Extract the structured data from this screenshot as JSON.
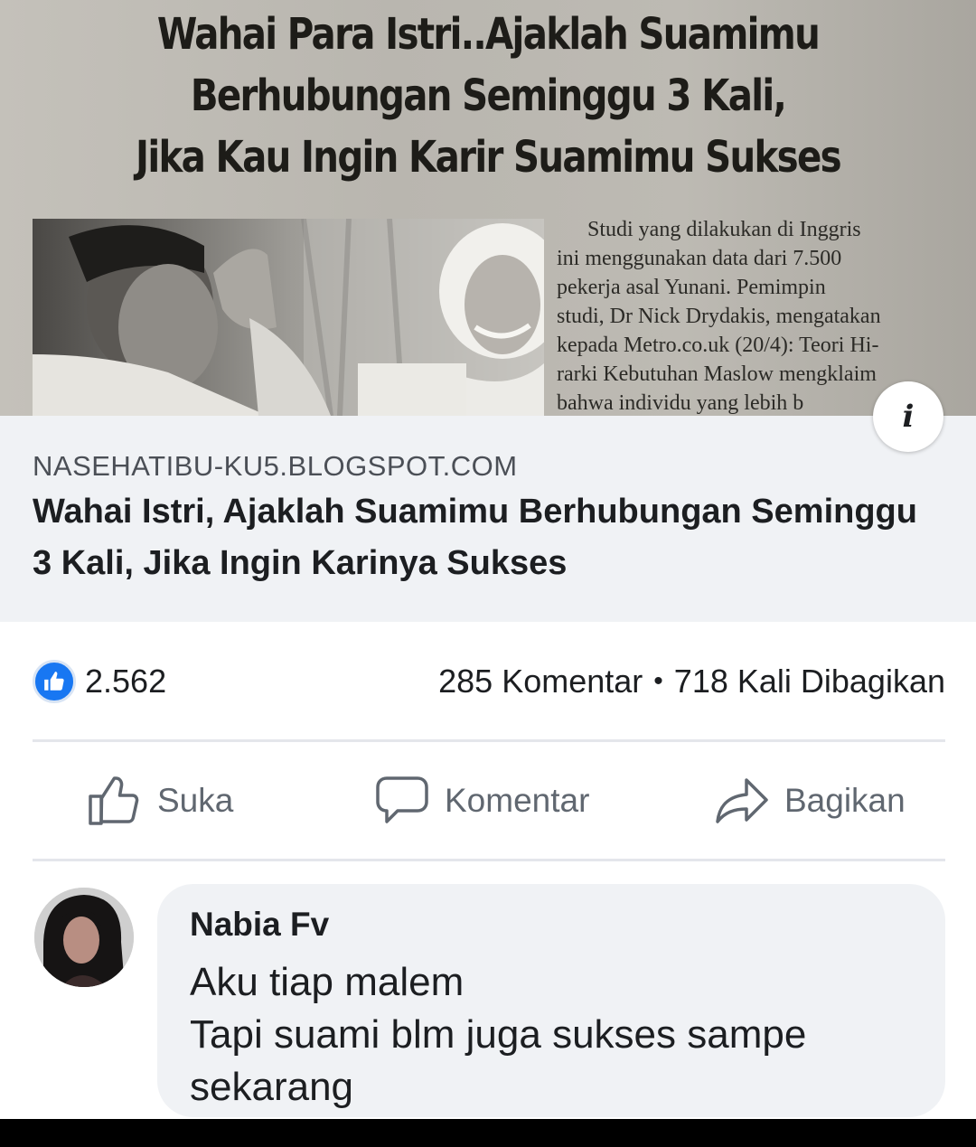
{
  "preview": {
    "headline": [
      "Wahai Para Istri..Ajaklah Suamimu",
      "Berhubungan Seminggu 3 Kali,",
      "Jika Kau Ingin Karir Suamimu Sukses"
    ],
    "article_lines": [
      "Studi yang dilakukan di Inggris",
      "ini menggunakan data dari 7.500",
      "pekerja asal Yunani. Pemimpin",
      "studi, Dr Nick Drydakis, mengatakan",
      "kepada Metro.co.uk (20/4): Teori Hi-",
      "rarki Kebutuhan Maslow mengklaim",
      "bahwa individu yang lebih b"
    ],
    "info_icon": "i"
  },
  "link": {
    "domain": "NASEHATIBU-KU5.BLOGSPOT.COM",
    "title": "Wahai Istri, Ajaklah Suamimu Berhubungan Seminggu 3 Kali, Jika Ingin Karinya Sukses"
  },
  "stats": {
    "reaction_count": "2.562",
    "comments": "285 Komentar",
    "separator": "•",
    "shares": "718 Kali Dibagikan"
  },
  "actions": {
    "like": "Suka",
    "comment": "Komentar",
    "share": "Bagikan"
  },
  "comment": {
    "author": "Nabia Fv",
    "text": "Aku tiap malem\nTapi suami blm juga sukses sampe\nsekarang"
  },
  "colors": {
    "like_blue": "#1877f2",
    "meta_bg": "#f0f2f5",
    "action_gray": "#606770"
  },
  "icons": {
    "like_badge": "thumbs-up-icon",
    "like": "thumbs-up-outline-icon",
    "comment": "speech-bubble-icon",
    "share": "share-arrow-icon",
    "info": "info-icon"
  }
}
